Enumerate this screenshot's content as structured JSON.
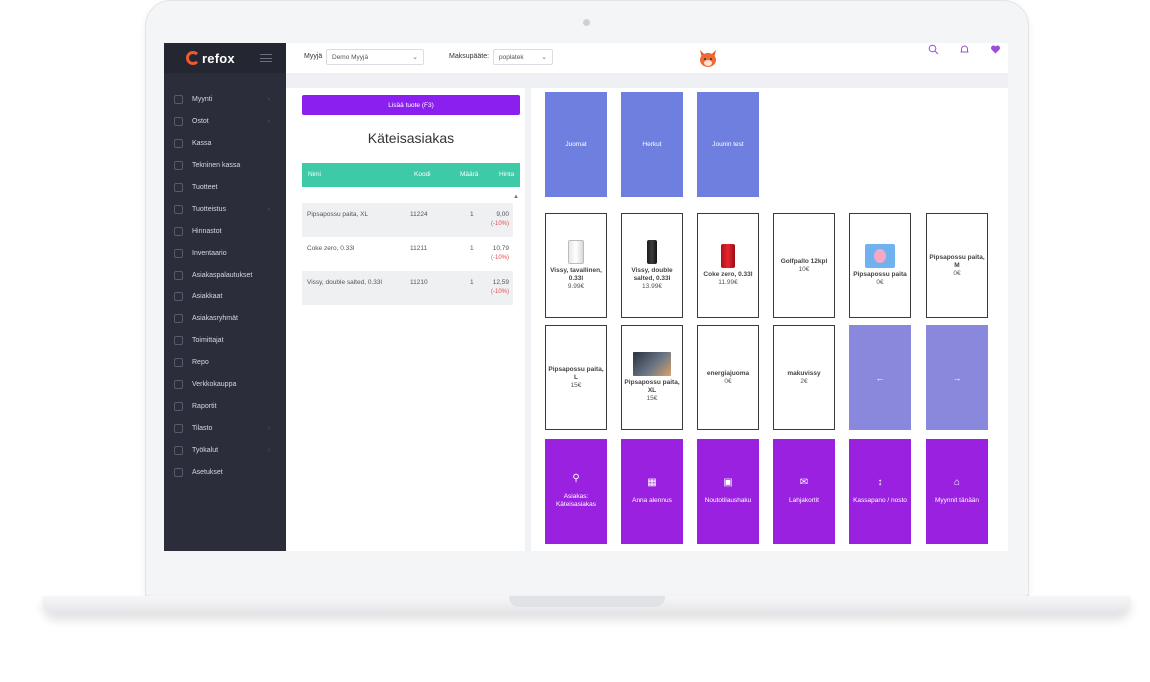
{
  "sidebar": {
    "logo_text": "refox",
    "items": [
      {
        "label": "Myynti",
        "has_children": true
      },
      {
        "label": "Ostot",
        "has_children": true
      },
      {
        "label": "Kassa",
        "has_children": false
      },
      {
        "label": "Tekninen kassa",
        "has_children": false
      },
      {
        "label": "Tuotteet",
        "has_children": false
      },
      {
        "label": "Tuotteistus",
        "has_children": true
      },
      {
        "label": "Hinnastot",
        "has_children": false
      },
      {
        "label": "Inventaario",
        "has_children": false
      },
      {
        "label": "Asiakaspalautukset",
        "has_children": false
      },
      {
        "label": "Asiakkaat",
        "has_children": false
      },
      {
        "label": "Asiakasryhmät",
        "has_children": false
      },
      {
        "label": "Toimittajat",
        "has_children": false
      },
      {
        "label": "Repo",
        "has_children": false
      },
      {
        "label": "Verkkokauppa",
        "has_children": false
      },
      {
        "label": "Raportit",
        "has_children": false
      },
      {
        "label": "Tilasto",
        "has_children": true
      },
      {
        "label": "Työkalut",
        "has_children": true
      },
      {
        "label": "Asetukset",
        "has_children": false
      }
    ]
  },
  "topbar": {
    "seller_label": "Myyjä",
    "seller_value": "Demo Myyjä",
    "terminal_label": "Maksupääte:",
    "terminal_value": "poplatek",
    "icons": [
      "search-icon",
      "bell-icon",
      "heart-icon",
      "coins-icon",
      "help-icon",
      "user-icon"
    ]
  },
  "cart": {
    "add_button": "Lisää tuote (F3)",
    "customer": "Käteisasiakas",
    "columns": {
      "name": "Nimi",
      "code": "Koodi",
      "qty": "Määrä",
      "price": "Hinta"
    },
    "rows": [
      {
        "name": "Pipsapossu paita, XL",
        "code": "11224",
        "qty": "1",
        "price": "9,00",
        "discount": "(-10%)"
      },
      {
        "name": "Coke zero, 0.33l",
        "code": "11211",
        "qty": "1",
        "price": "10,79",
        "discount": "(-10%)"
      },
      {
        "name": "Vissy, double salted, 0.33l",
        "code": "11210",
        "qty": "1",
        "price": "12,59",
        "discount": "(-10%)"
      }
    ]
  },
  "categories": [
    "Juomat",
    "Herkut",
    "Jounin test"
  ],
  "products": [
    {
      "name": "Vissy, tavallinen, 0.33l",
      "price": "9.99€",
      "image": "can-white"
    },
    {
      "name": "Vissy, double salted, 0.33l",
      "price": "13.99€",
      "image": "can-black"
    },
    {
      "name": "Coke zero, 0.33l",
      "price": "11.99€",
      "image": "can-red"
    },
    {
      "name": "Golfpallo 12kpl",
      "price": "10€",
      "image": ""
    },
    {
      "name": "Pipsapossu paita",
      "price": "0€",
      "image": "pig"
    },
    {
      "name": "Pipsapossu paita, M",
      "price": "0€",
      "image": ""
    },
    {
      "name": "Pipsapossu paita, L",
      "price": "15€",
      "image": ""
    },
    {
      "name": "Pipsapossu paita, XL",
      "price": "15€",
      "image": "photo"
    },
    {
      "name": "energiajuoma",
      "price": "0€",
      "image": ""
    },
    {
      "name": "makuvissy",
      "price": "2€",
      "image": ""
    }
  ],
  "pager": {
    "prev": "←",
    "next": "→"
  },
  "actions": [
    {
      "label": "Asiakas: Käteisasiakas",
      "icon": "user-icon",
      "glyph": "⚲"
    },
    {
      "label": "Anna alennus",
      "icon": "calculator-icon",
      "glyph": "▦"
    },
    {
      "label": "Noutotilaushaku",
      "icon": "archive-icon",
      "glyph": "▣"
    },
    {
      "label": "Lahjakortit",
      "icon": "mail-icon",
      "glyph": "✉"
    },
    {
      "label": "Kassapano / nosto",
      "icon": "transfer-icon",
      "glyph": "↕"
    },
    {
      "label": "Myynnit tänään",
      "icon": "bank-icon",
      "glyph": "⌂"
    }
  ]
}
